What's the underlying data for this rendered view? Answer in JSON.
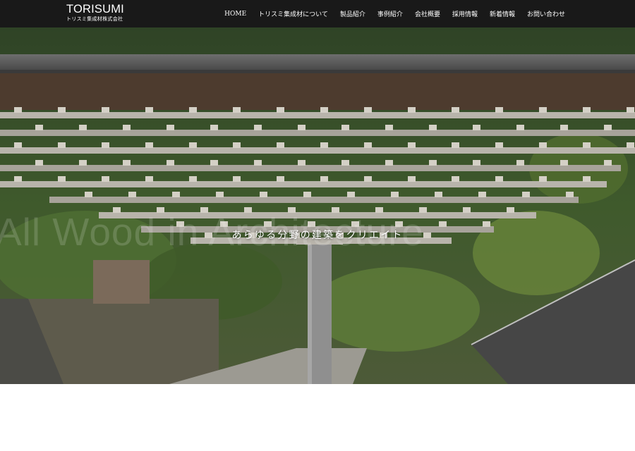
{
  "header": {
    "logo_main": "TORISUMI",
    "logo_sub": "トリスミ集成材株式会社"
  },
  "nav": [
    {
      "label": "HOME"
    },
    {
      "label": "トリスミ集成材について"
    },
    {
      "label": "製品紹介"
    },
    {
      "label": "事例紹介"
    },
    {
      "label": "会社概要"
    },
    {
      "label": "採用情報"
    },
    {
      "label": "新着情報"
    },
    {
      "label": "お問い合わせ"
    }
  ],
  "hero": {
    "background_text": "All Wood in Architecture",
    "tagline": "あらゆる分野の建築をクリエイト"
  },
  "colors": {
    "header_bg": "#191919",
    "text": "#ffffff",
    "page_bg": "#ffffff"
  }
}
